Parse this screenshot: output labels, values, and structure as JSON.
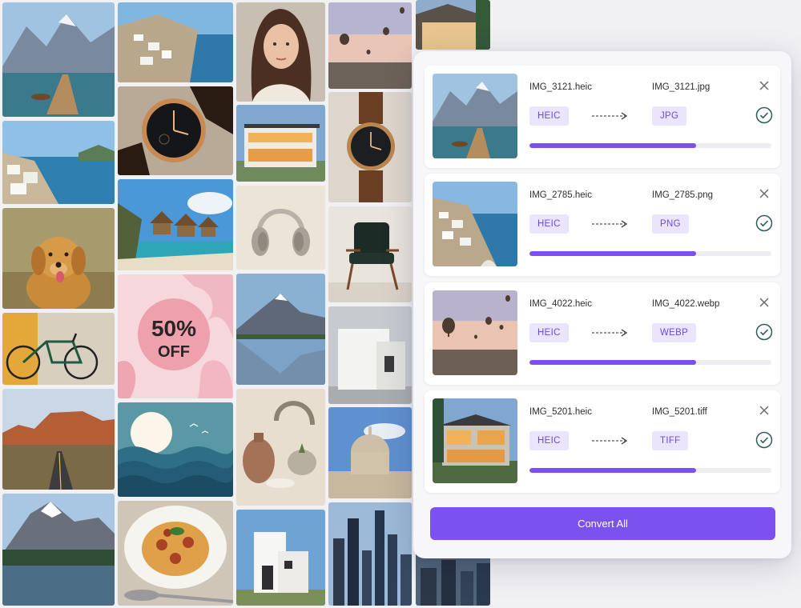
{
  "files": [
    {
      "source_name": "IMG_3121.heic",
      "target_name": "IMG_3121.jpg",
      "source_format": "HEIC",
      "target_format": "JPG",
      "progress": 0.69,
      "status": "done"
    },
    {
      "source_name": "IMG_2785.heic",
      "target_name": "IMG_2785.png",
      "source_format": "HEIC",
      "target_format": "PNG",
      "progress": 0.69,
      "status": "done"
    },
    {
      "source_name": "IMG_4022.heic",
      "target_name": "IMG_4022.webp",
      "source_format": "HEIC",
      "target_format": "WEBP",
      "progress": 0.69,
      "status": "done"
    },
    {
      "source_name": "IMG_5201.heic",
      "target_name": "IMG_5201.tiff",
      "source_format": "HEIC",
      "target_format": "TIFF",
      "progress": 0.69,
      "status": "done"
    }
  ],
  "convert_all_label": "Convert All",
  "promo": {
    "line1": "50%",
    "line2": "OFF"
  },
  "colors": {
    "accent": "#7b52f0",
    "chip_bg": "#ebe4fd",
    "chip_text": "#6c4bd8",
    "check": "#2f5b5c"
  },
  "icons": {
    "close": "close-icon",
    "done": "check-circle-icon",
    "arrow": "dashed-arrow-icon"
  }
}
